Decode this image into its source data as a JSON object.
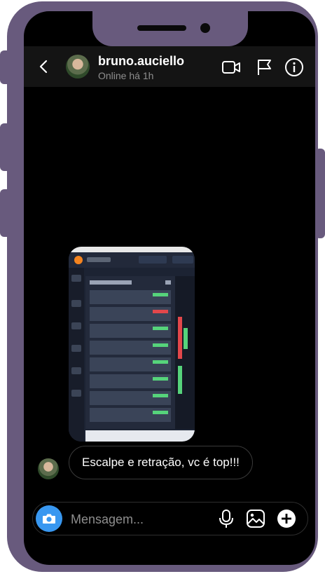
{
  "header": {
    "username": "bruno.auciello",
    "status": "Online há 1h",
    "icons": [
      "back-icon",
      "video-call-icon",
      "flag-icon",
      "info-icon"
    ]
  },
  "thread": {
    "messages": [
      {
        "type": "image",
        "description_icon": "shared-screenshot"
      },
      {
        "type": "text",
        "text": "Escalpe e retração, vc é top!!!"
      }
    ]
  },
  "composer": {
    "placeholder": "Mensagem...",
    "icons": [
      "camera-icon",
      "microphone-icon",
      "gallery-icon",
      "plus-icon"
    ]
  },
  "colors": {
    "frame": "#685a7d",
    "accent": "#3897f0",
    "background": "#000000"
  }
}
